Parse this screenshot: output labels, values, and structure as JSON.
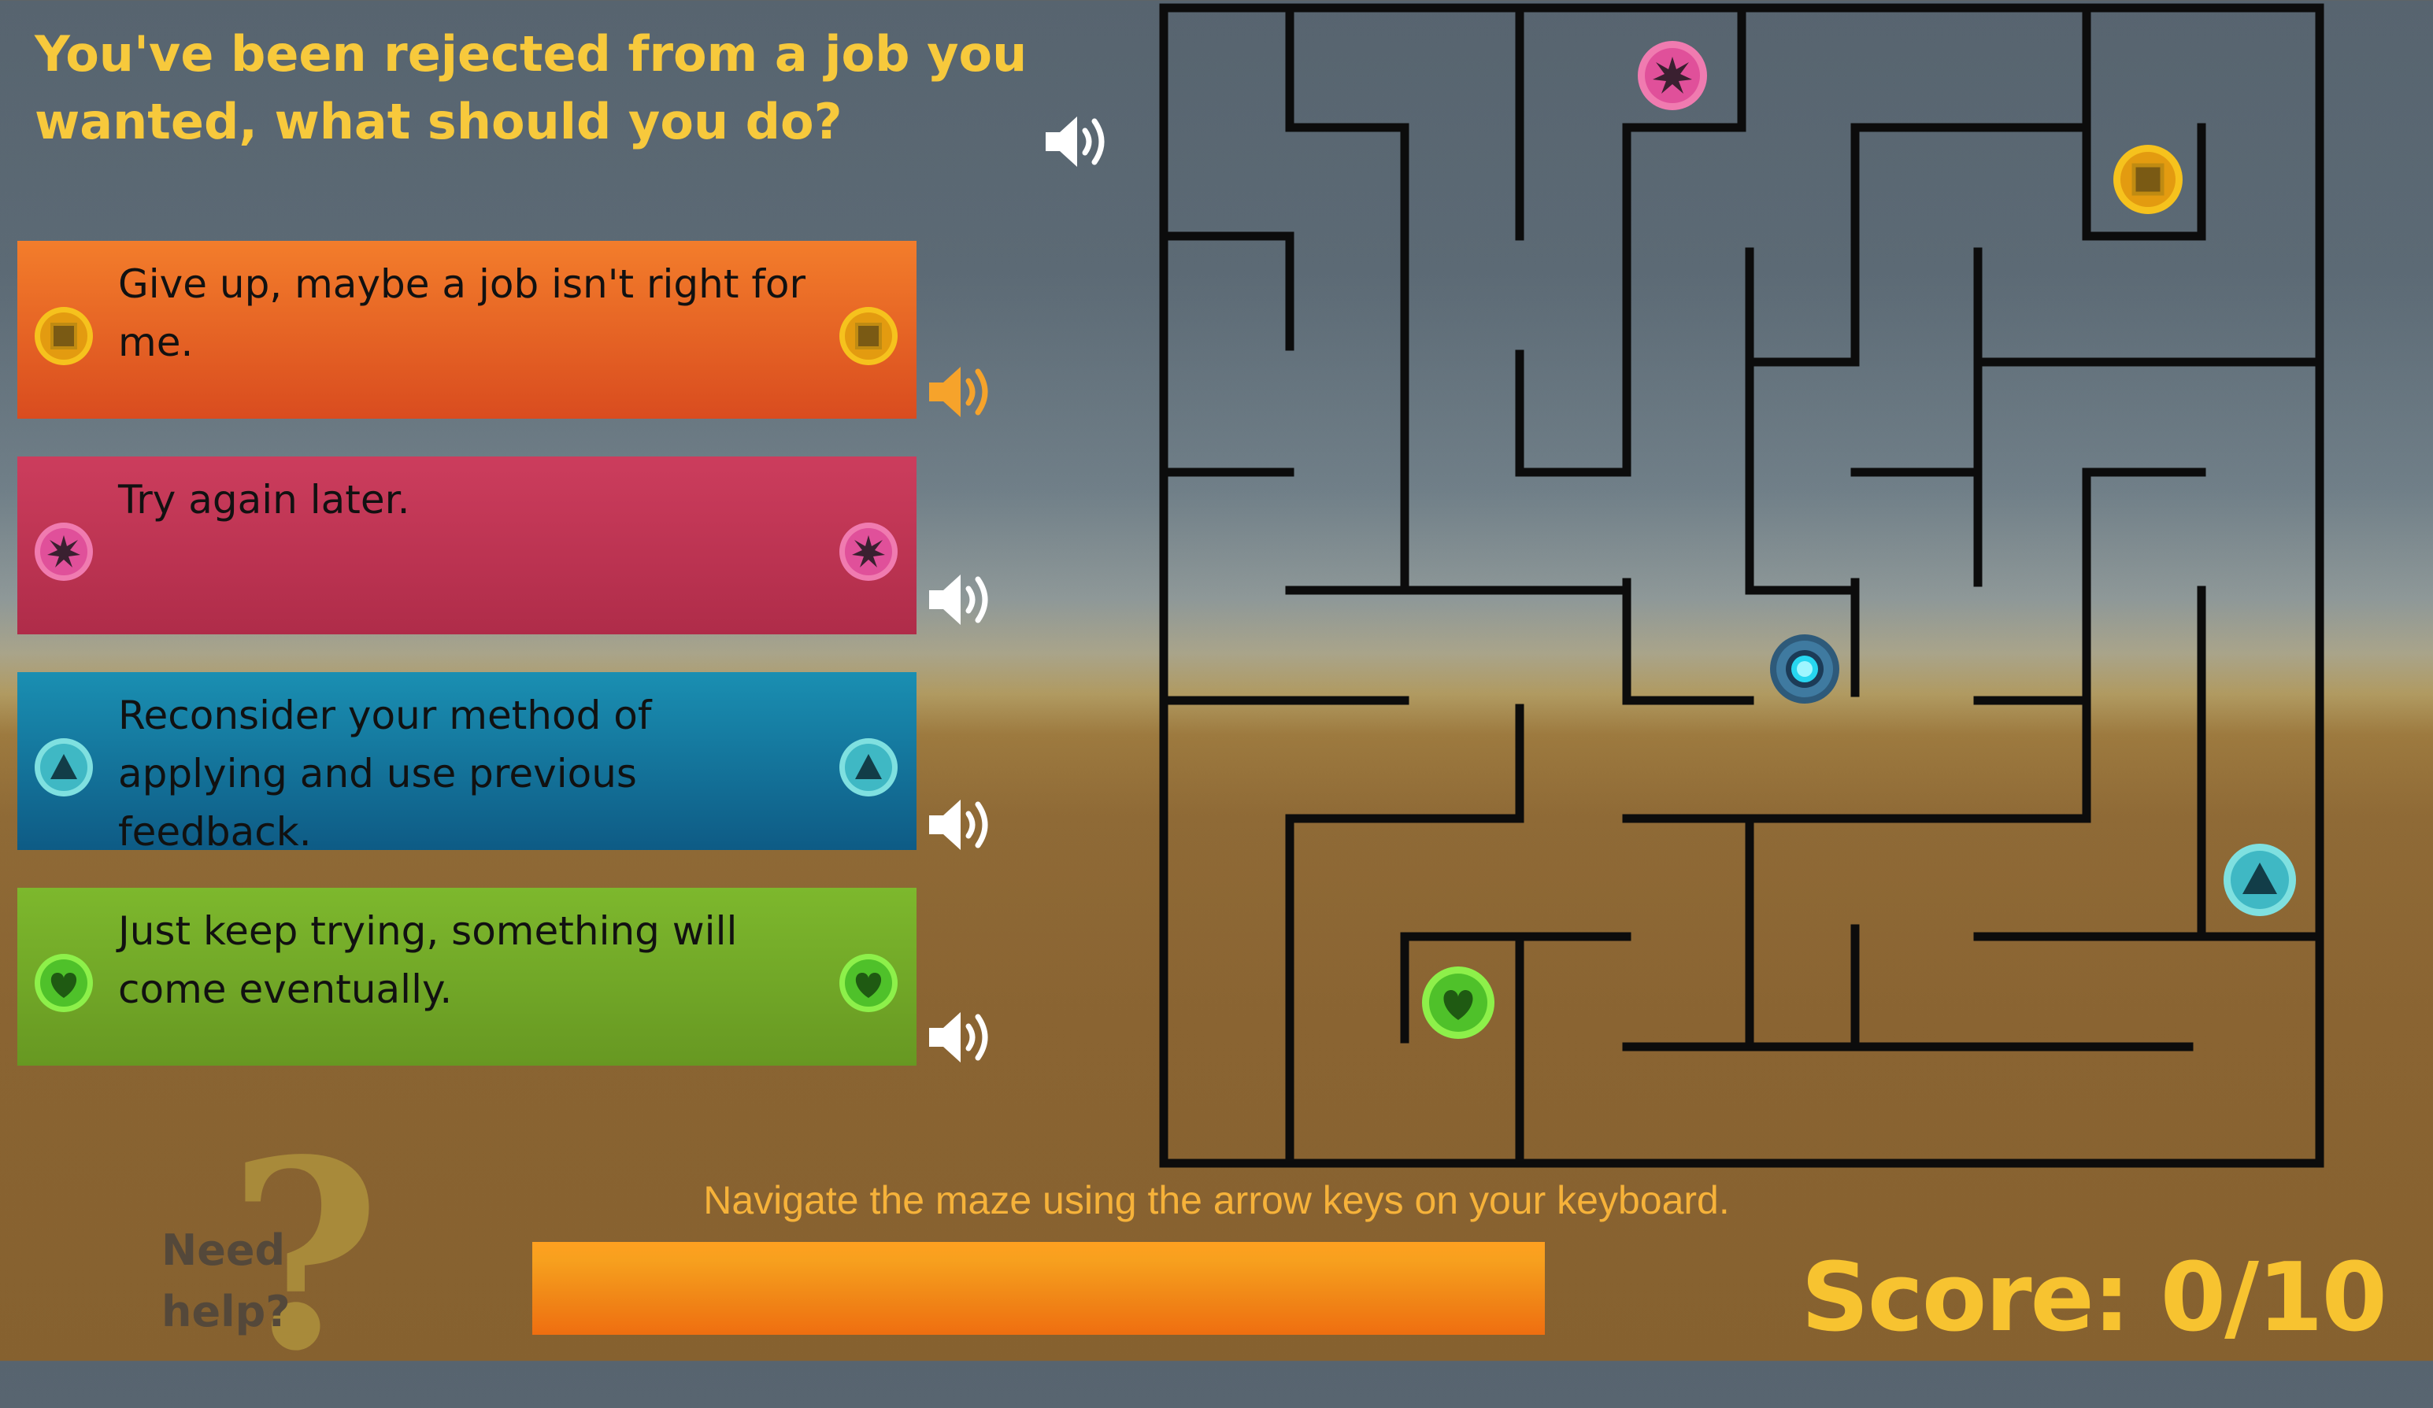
{
  "question": {
    "line1": "You've been rejected from a job you",
    "line2": "wanted, what should you do?"
  },
  "answers": [
    {
      "lines": [
        "Give up, maybe a job isn't right for",
        "me."
      ],
      "color_top": "#f2792a",
      "color_bottom": "#d94e20",
      "icon": "gold-square-coin",
      "speaker_color": "#f6a32b"
    },
    {
      "lines": [
        "Try again later."
      ],
      "color_top": "#cb3c5c",
      "color_bottom": "#b02d4a",
      "icon": "pink-splat-coin",
      "speaker_color": "#ffffff"
    },
    {
      "lines": [
        "Reconsider your method of",
        "applying and use previous",
        "feedback."
      ],
      "color_top": "#1a8cae",
      "color_bottom": "#0f5e87",
      "icon": "teal-triangle-coin",
      "speaker_color": "#ffffff"
    },
    {
      "lines": [
        "Just keep trying, something will",
        "come eventually."
      ],
      "color_top": "#7ab52c",
      "color_bottom": "#6a9a22",
      "icon": "green-heart-coin",
      "speaker_color": "#ffffff"
    }
  ],
  "instruction": "Navigate the maze using the arrow keys on your keyboard.",
  "help": {
    "line1": "Need",
    "line2": "help?",
    "mark": "?"
  },
  "score": {
    "label": "Score:",
    "value": "0/10"
  },
  "progress": {
    "fraction": 1.0
  },
  "colors": {
    "title": "#f7c93c",
    "score": "#f7c330",
    "instruction": "#f6b23a"
  }
}
